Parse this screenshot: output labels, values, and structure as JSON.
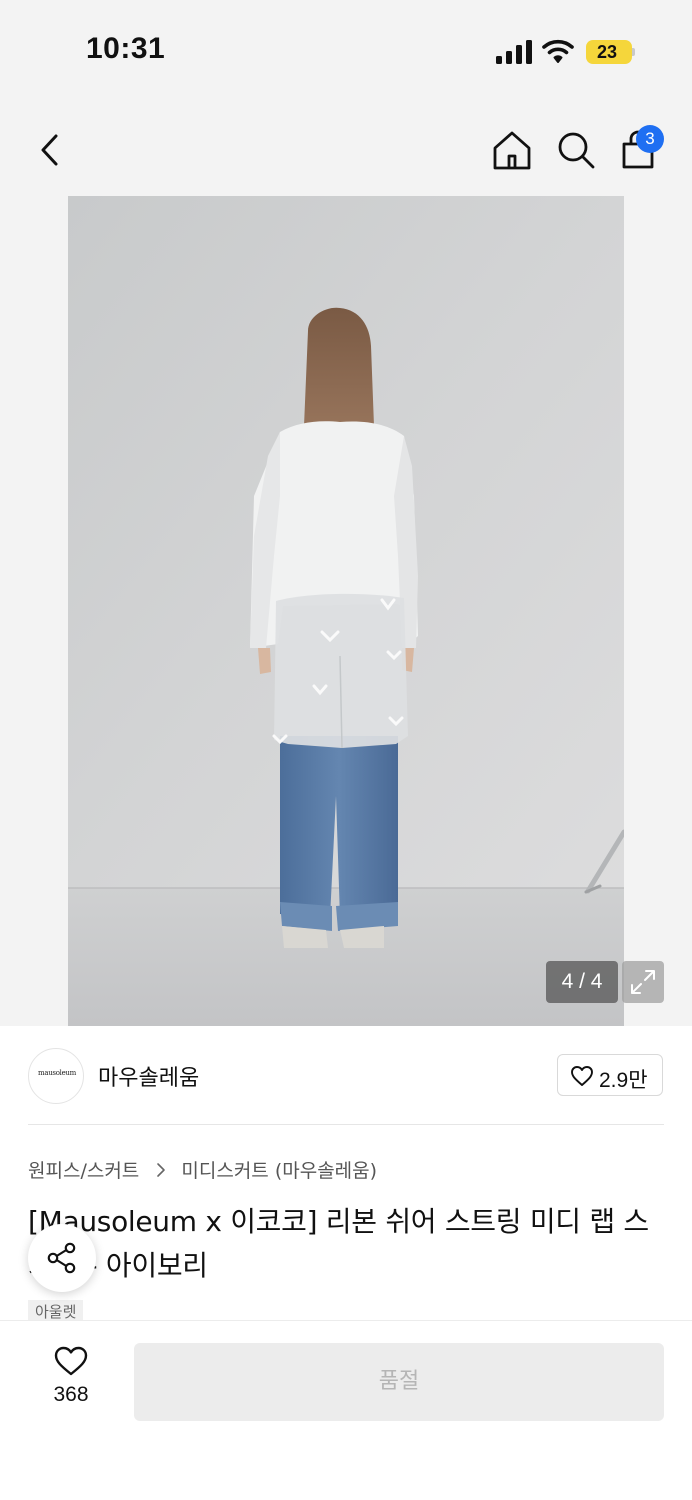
{
  "status_bar": {
    "time": "10:31",
    "battery": "23"
  },
  "nav": {
    "back_icon": "chevron-left-icon",
    "home_icon": "home-icon",
    "search_icon": "search-icon",
    "cart_icon": "shopping-bag-icon",
    "cart_count": "3"
  },
  "gallery": {
    "counter": "4 / 4",
    "expand_icon": "expand-icon"
  },
  "brand": {
    "logo_text": "mausoleum",
    "name": "마우솔레움",
    "likes": "2.9만"
  },
  "breadcrumb": {
    "category": "원피스/스커트",
    "subcategory": "미디스커트 (마우솔레움)"
  },
  "product": {
    "title": "[Mausoleum x 이코코] 리본 쉬어 스트링 미디 랩 스커트 - 아이보리",
    "tag": "아울렛"
  },
  "bottom_bar": {
    "wish_count": "368",
    "buy_label": "품절"
  },
  "colors": {
    "accent": "#1f6ff2",
    "battery": "#f5d63b",
    "soldout_bg": "#ececec",
    "soldout_text": "#b5b5b5"
  }
}
